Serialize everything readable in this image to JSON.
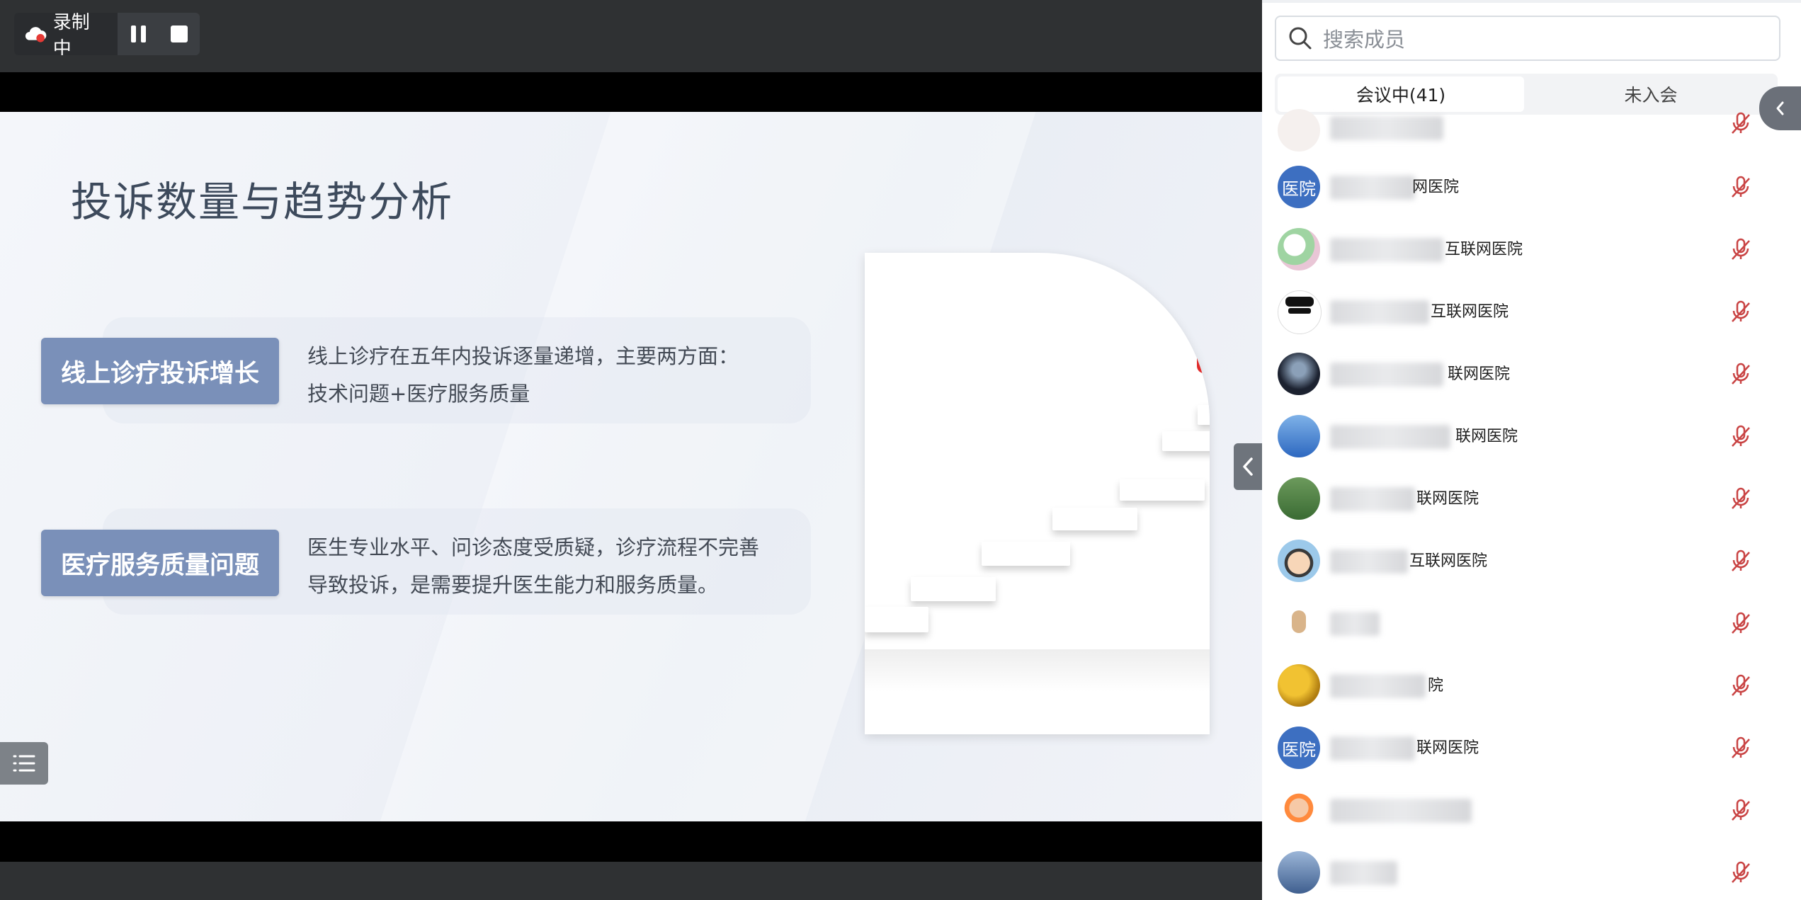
{
  "recording": {
    "status": "录制中"
  },
  "slide": {
    "title": "投诉数量与趋势分析",
    "items": [
      {
        "tag": "线上诊疗投诉增长",
        "line1": "线上诊疗在五年内投诉逐量递增，主要两方面：",
        "line2": "技术问题+医疗服务质量"
      },
      {
        "tag": "医疗服务质量问题",
        "line1": "医生专业水平、问诊态度受质疑，诊疗流程不完善",
        "line2": "导致投诉，是需要提升医生能力和服务质量。"
      }
    ]
  },
  "panel": {
    "search_placeholder": "搜索成员",
    "tab_in": "会议中(41)",
    "tab_out": "未入会",
    "members": [
      {
        "avatar": "",
        "name_suffix": ""
      },
      {
        "avatar": "医院",
        "name_suffix": "网医院"
      },
      {
        "avatar": "",
        "name_suffix": "互联网医院"
      },
      {
        "avatar": "",
        "name_suffix": "互联网医院"
      },
      {
        "avatar": "",
        "name_suffix": "联网医院"
      },
      {
        "avatar": "",
        "name_suffix": "联网医院"
      },
      {
        "avatar": "",
        "name_suffix": "联网医院"
      },
      {
        "avatar": "",
        "name_suffix": "互联网医院"
      },
      {
        "avatar": "",
        "name_suffix": ""
      },
      {
        "avatar": "",
        "name_suffix": "院"
      },
      {
        "avatar": "医院",
        "name_suffix": "联网医院"
      },
      {
        "avatar": "",
        "name_suffix": ""
      },
      {
        "avatar": "",
        "name_suffix": ""
      }
    ]
  },
  "colors": {
    "tag_bg": "#7a90b9",
    "avatar_blue": "#3d6fc1",
    "mic_muted": "#d84a4a"
  }
}
